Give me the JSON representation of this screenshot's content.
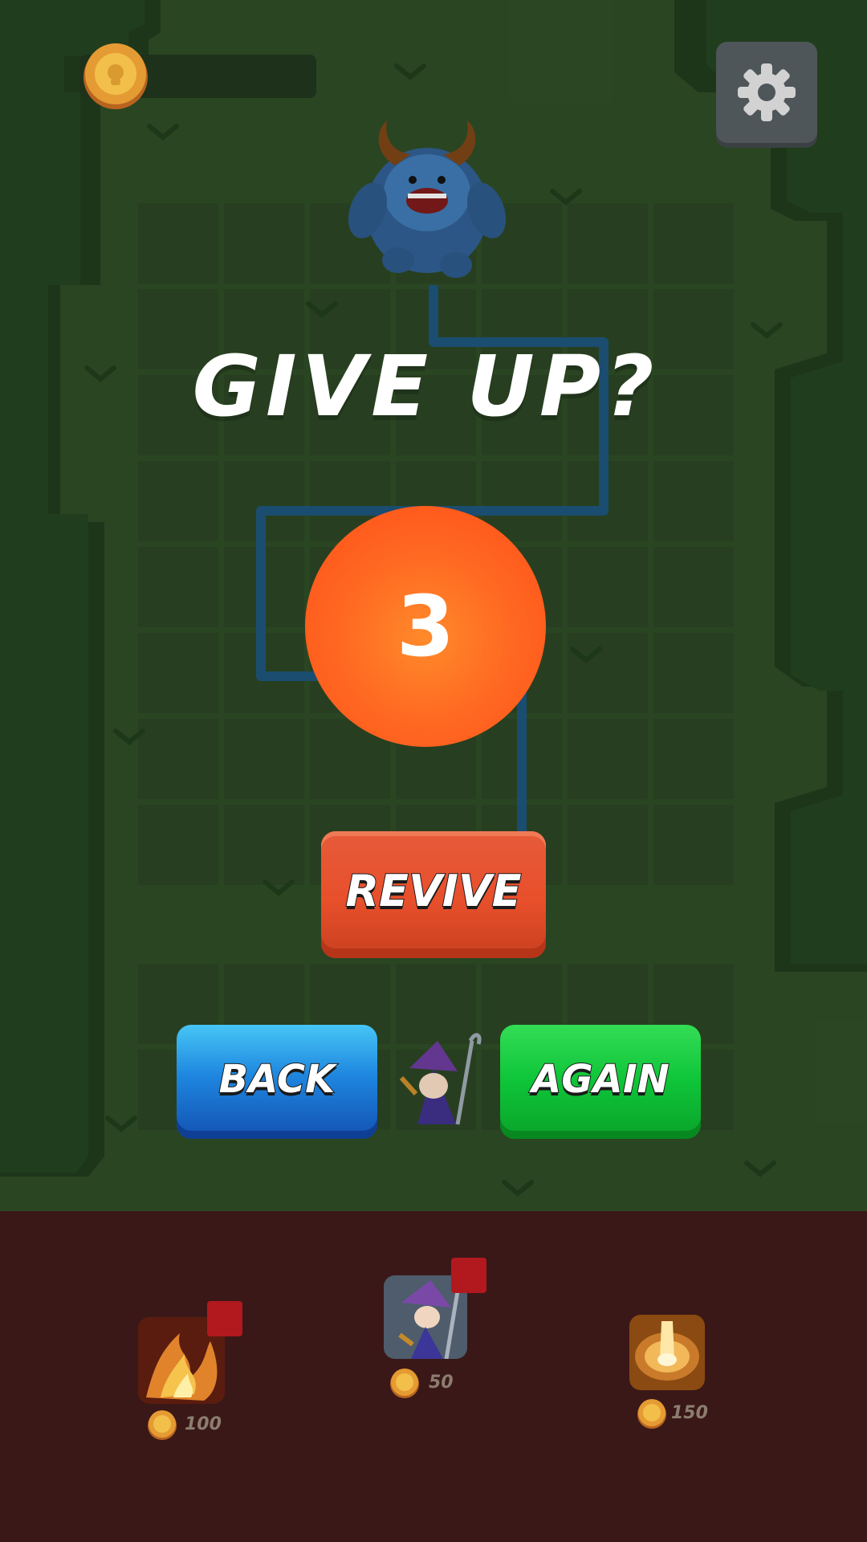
{
  "hud": {
    "coin_count": "",
    "settings_icon": "gear-icon"
  },
  "dialog": {
    "title": "GIVE UP?",
    "countdown": "3",
    "revive_label": "REVIVE",
    "back_label": "BACK",
    "again_label": "AGAIN"
  },
  "shop": {
    "items": [
      {
        "name": "fire-ability",
        "price": "100"
      },
      {
        "name": "wizard-hero",
        "price": "50"
      },
      {
        "name": "light-blast-ability",
        "price": "150"
      }
    ]
  },
  "colors": {
    "background": "#2d4a25",
    "revive": "#e84f2b",
    "back": "#1e86df",
    "again": "#0ec438",
    "countdown": "#ff6a22",
    "shop_panel": "#3a1818",
    "badge": "#b1191f"
  }
}
